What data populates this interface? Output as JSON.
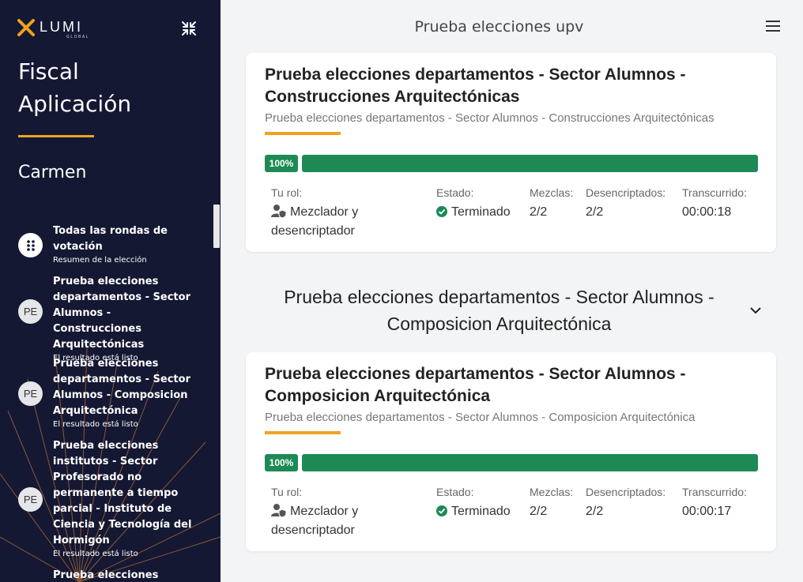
{
  "brand": {
    "name": "LUMI",
    "subtitle": "GLOBAL",
    "accent": "#f0a21e",
    "sidebar_bg": "#141833",
    "success": "#1d8a55"
  },
  "sidebar": {
    "title_line1": "Fiscal",
    "title_line2": "Aplicación",
    "user": "Carmen",
    "collapse_icon": "collapse-arrows-icon",
    "items": [
      {
        "badge": "",
        "title": "Todas las rondas de votación",
        "subtitle": "Resumen de la elección",
        "icon": "grid-icon"
      },
      {
        "badge": "PE",
        "title": "Prueba elecciones departamentos - Sector Alumnos - Construcciones Arquitectónicas",
        "subtitle": "El resultado está listo"
      },
      {
        "badge": "PE",
        "title": "Prueba elecciones departamentos - Sector Alumnos - Composicion Arquitectónica",
        "subtitle": "El resultado está listo"
      },
      {
        "badge": "PE",
        "title": "Prueba elecciones institutos - Sector Profesorado no permanente a tiempo parcial - Instituto de Ciencia y Tecnología del Hormigón",
        "subtitle": "El resultado está listo"
      },
      {
        "badge": "",
        "title": "Prueba elecciones",
        "subtitle": ""
      }
    ]
  },
  "header": {
    "title": "Prueba elecciones upv",
    "menu_icon": "hamburger-menu-icon"
  },
  "labels": {
    "role": "Tu rol:",
    "status": "Estado:",
    "mixes": "Mezclas:",
    "decrypted": "Desencriptados:",
    "elapsed": "Transcurrido:"
  },
  "cards": [
    {
      "title": "Prueba elecciones departamentos - Sector Alumnos - Construcciones Arquitectónicas",
      "subtitle": "Prueba elecciones departamentos - Sector Alumnos - Construcciones Arquitectónicas",
      "progress_label": "100%",
      "progress": 1.0,
      "role": "Mezclador y desencriptador",
      "status": "Terminado",
      "mixes": "2/2",
      "decrypted": "2/2",
      "elapsed": "00:00:18"
    },
    {
      "title": "Prueba elecciones departamentos - Sector Alumnos - Composicion Arquitectónica",
      "subtitle": "Prueba elecciones departamentos - Sector Alumnos - Composicion Arquitectónica",
      "progress_label": "100%",
      "progress": 1.0,
      "role": "Mezclador y desencriptador",
      "status": "Terminado",
      "mixes": "2/2",
      "decrypted": "2/2",
      "elapsed": "00:00:17"
    }
  ],
  "section": {
    "title": "Prueba elecciones departamentos - Sector Alumnos - Composicion Arquitectónica",
    "toggle_icon": "chevron-down-icon"
  }
}
